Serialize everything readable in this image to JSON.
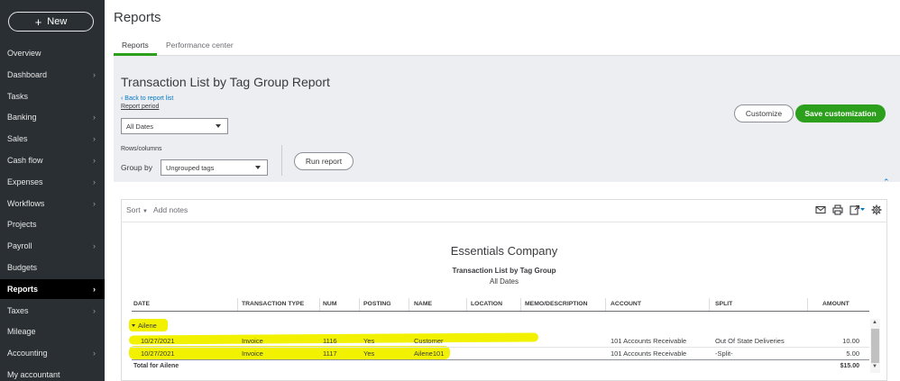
{
  "sidebar": {
    "new_label": "New",
    "items": [
      {
        "label": "Overview",
        "chevron": false
      },
      {
        "label": "Dashboard",
        "chevron": true
      },
      {
        "label": "Tasks",
        "chevron": false
      },
      {
        "label": "Banking",
        "chevron": true
      },
      {
        "label": "Sales",
        "chevron": true
      },
      {
        "label": "Cash flow",
        "chevron": true
      },
      {
        "label": "Expenses",
        "chevron": true
      },
      {
        "label": "Workflows",
        "chevron": true
      },
      {
        "label": "Projects",
        "chevron": false
      },
      {
        "label": "Payroll",
        "chevron": true
      },
      {
        "label": "Budgets",
        "chevron": false
      },
      {
        "label": "Reports",
        "chevron": true,
        "active": true
      },
      {
        "label": "Taxes",
        "chevron": true
      },
      {
        "label": "Mileage",
        "chevron": false
      },
      {
        "label": "Accounting",
        "chevron": true
      },
      {
        "label": "My accountant",
        "chevron": false
      }
    ]
  },
  "page": {
    "title": "Reports",
    "tabs": [
      "Reports",
      "Performance center"
    ]
  },
  "report_header": {
    "title": "Transaction List by Tag Group Report",
    "back_link": "Back to report list",
    "period_label": "Report period",
    "period_value": "All Dates",
    "rows_columns_label": "Rows/columns",
    "group_by_label": "Group by",
    "group_by_value": "Ungrouped tags",
    "run_report": "Run report",
    "customize": "Customize",
    "save_customization": "Save customization"
  },
  "toolbar": {
    "sort": "Sort",
    "add_notes": "Add notes"
  },
  "report": {
    "company": "Essentials Company",
    "subtitle": "Transaction List by Tag Group",
    "dates": "All Dates",
    "columns": [
      "DATE",
      "TRANSACTION TYPE",
      "NUM",
      "POSTING",
      "NAME",
      "LOCATION",
      "MEMO/DESCRIPTION",
      "ACCOUNT",
      "SPLIT",
      "AMOUNT"
    ],
    "group_name": "Ailene",
    "rows": [
      {
        "date": "10/27/2021",
        "type": "Invoice",
        "num": "1116",
        "posting": "Yes",
        "name": "Customer",
        "location": "",
        "memo": "",
        "account": "101 Accounts Receivable",
        "split": "Out Of State Deliveries",
        "amount": "10.00"
      },
      {
        "date": "10/27/2021",
        "type": "Invoice",
        "num": "1117",
        "posting": "Yes",
        "name": "Ailene101",
        "location": "",
        "memo": "",
        "account": "101 Accounts Receivable",
        "split": "-Split-",
        "amount": "5.00"
      }
    ],
    "total_label": "Total for Ailene",
    "total_amount": "$15.00"
  },
  "colors": {
    "sidebar_bg": "#2a2f33",
    "accent_green": "#2ca01c",
    "link_blue": "#0077c5",
    "highlight_yellow": "#f2f200"
  }
}
